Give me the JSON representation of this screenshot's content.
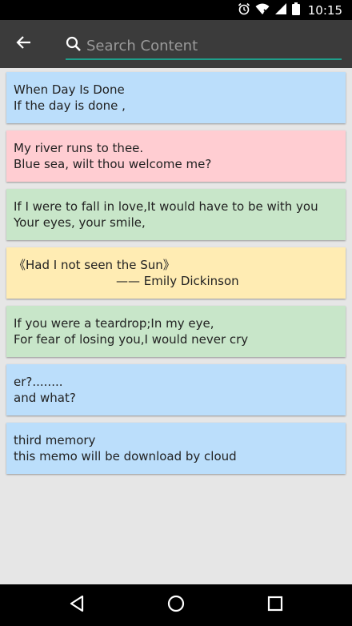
{
  "status_bar": {
    "time": "10:15",
    "icons": [
      "alarm-icon",
      "wifi-icon",
      "signal-icon",
      "battery-icon"
    ]
  },
  "app_bar": {
    "back_icon": "arrow-left-icon",
    "search": {
      "placeholder": "Search Content",
      "value": "",
      "accent_color": "#1f9e8a"
    }
  },
  "memos": [
    {
      "line1": "When Day Is Done",
      "line2": "If the day is done ,",
      "color": "#bbdefb"
    },
    {
      "line1": "My river runs to thee.",
      "line2": "Blue sea, wilt thou welcome me?",
      "color": "#ffcdd2"
    },
    {
      "line1": "If I were to fall in love,It would have to be with you",
      "line2": "Your eyes, your smile,",
      "color": "#c8e6c9"
    },
    {
      "line1": "《Had I not seen the Sun》",
      "line2": "—— Emily Dickinson",
      "color": "#ffecb3"
    },
    {
      "line1": "If you were a teardrop;In my eye,",
      "line2": "For fear of losing you,I would never cry",
      "color": "#c8e6c9"
    },
    {
      "line1": "er?........",
      "line2": "and what?",
      "color": "#bbdefb"
    },
    {
      "line1": "third memory",
      "line2": "this memo will be download by cloud",
      "color": "#bbdefb"
    }
  ],
  "nav_bar": {
    "icons": [
      "back-triangle-icon",
      "home-circle-icon",
      "recents-square-icon"
    ]
  }
}
